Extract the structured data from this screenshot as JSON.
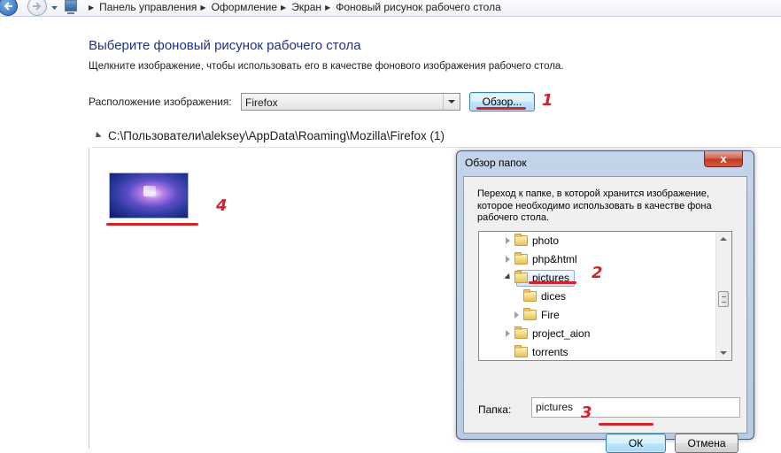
{
  "breadcrumb": {
    "items": [
      "Панель управления",
      "Оформление",
      "Экран",
      "Фоновый рисунок рабочего стола"
    ]
  },
  "main": {
    "title": "Выберите фоновый рисунок рабочего стола",
    "description": "Щелкните изображение, чтобы использовать его в качестве фонового изображения рабочего стола.",
    "location_label": "Расположение изображения:",
    "location_value": "Firefox",
    "browse_label": "Обзор...",
    "group_title": "C:\\Пользователи\\aleksey\\AppData\\Roaming\\Mozilla\\Firefox (1)"
  },
  "annotations": [
    "1",
    "2",
    "3",
    "4"
  ],
  "dialog": {
    "title": "Обзор папок",
    "close_label": "x",
    "description": "Переход к папке, в которой хранится изображение, которое необходимо использовать в качестве фона рабочего стола.",
    "tree": [
      {
        "label": "photo"
      },
      {
        "label": "php&html"
      },
      {
        "label": "pictures"
      },
      {
        "label": "dices"
      },
      {
        "label": "Fire"
      },
      {
        "label": "project_aion"
      },
      {
        "label": "torrents"
      }
    ],
    "folder_label": "Папка:",
    "folder_value": "pictures",
    "ok_label": "ОК",
    "cancel_label": "Отмена"
  },
  "colors": {
    "annotation": "#d2232a",
    "title": "#1e3287"
  }
}
